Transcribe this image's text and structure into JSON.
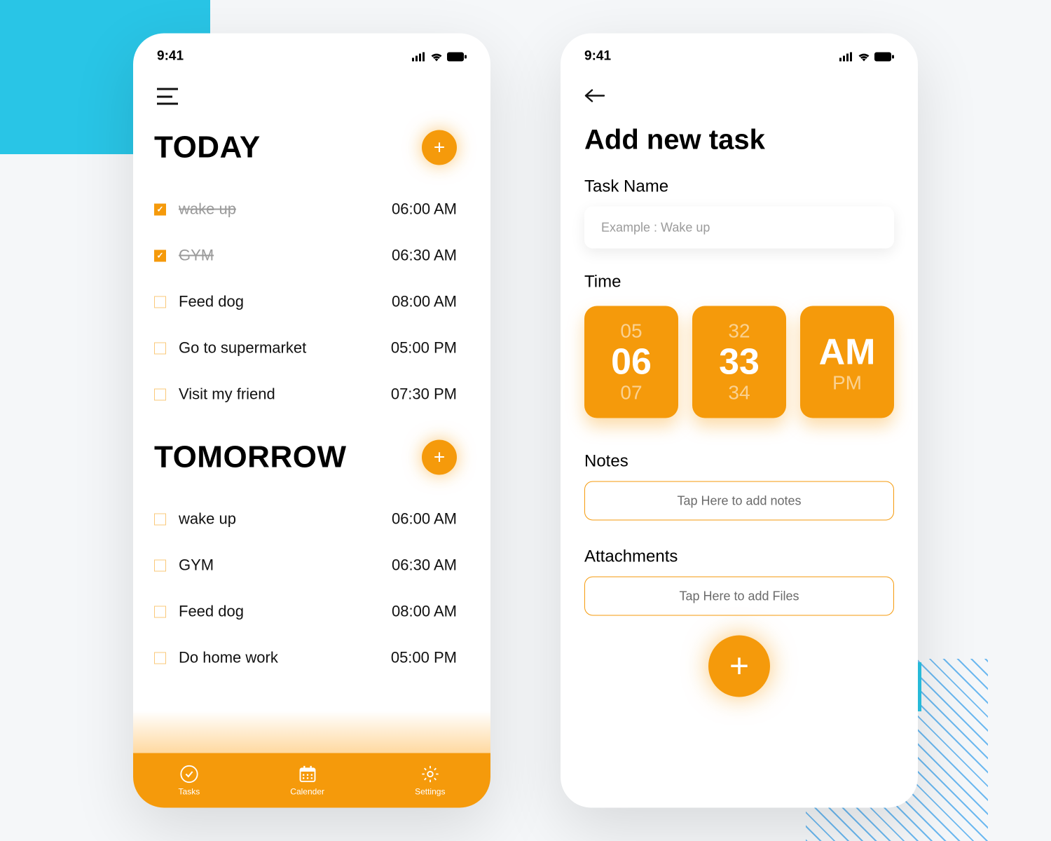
{
  "status": {
    "time": "9:41"
  },
  "screen1": {
    "today": {
      "heading": "TODAY",
      "tasks": [
        {
          "label": "wake up",
          "time": "06:00 AM",
          "done": true
        },
        {
          "label": "GYM",
          "time": "06:30 AM",
          "done": true
        },
        {
          "label": "Feed dog",
          "time": "08:00 AM",
          "done": false
        },
        {
          "label": "Go to supermarket",
          "time": "05:00 PM",
          "done": false
        },
        {
          "label": "Visit my friend",
          "time": "07:30 PM",
          "done": false
        }
      ]
    },
    "tomorrow": {
      "heading": "TOMORROW",
      "tasks": [
        {
          "label": "wake up",
          "time": "06:00 AM",
          "done": false
        },
        {
          "label": "GYM",
          "time": "06:30 AM",
          "done": false
        },
        {
          "label": "Feed dog",
          "time": "08:00 AM",
          "done": false
        },
        {
          "label": "Do home work",
          "time": "05:00 PM",
          "done": false
        }
      ]
    },
    "nav": {
      "tasks": "Tasks",
      "calendar": "Calender",
      "settings": "Settings"
    }
  },
  "screen2": {
    "title": "Add new task",
    "task_name_label": "Task Name",
    "task_name_placeholder": "Example : Wake up",
    "time_label": "Time",
    "time": {
      "hour_prev": "05",
      "hour": "06",
      "hour_next": "07",
      "min_prev": "32",
      "min": "33",
      "min_next": "34",
      "ampm_prev": "",
      "ampm": "AM",
      "ampm_next": "PM"
    },
    "notes_label": "Notes",
    "notes_placeholder": "Tap Here to add notes",
    "attachments_label": "Attachments",
    "attachments_placeholder": "Tap Here to add Files"
  }
}
